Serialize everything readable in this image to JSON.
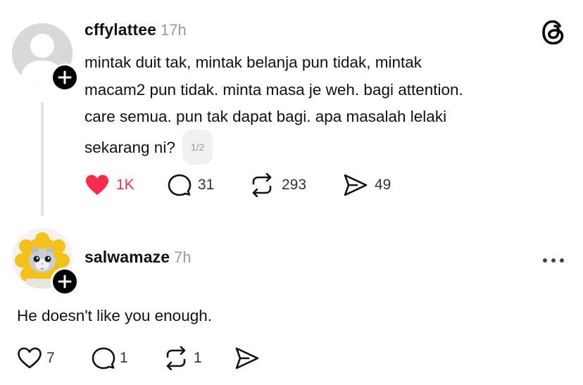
{
  "post": {
    "username": "cffylattee",
    "time": "17h",
    "text_lines": [
      "mintak duit tak, mintak belanja pun tidak, mintak",
      "macam2 pun tidak. minta masa je weh. bagi attention.",
      "care semua. pun tak dapat bagi. apa masalah lelaki",
      "sekarang ni?"
    ],
    "pager": "1/2",
    "likes": "1K",
    "comments": "31",
    "reposts": "293",
    "shares": "49"
  },
  "reply": {
    "username": "salwamaze",
    "time": "7h",
    "text": "He doesn't like you enough.",
    "likes": "7",
    "comments": "1",
    "reposts": "1"
  },
  "colors": {
    "like_active": "#ff2b4d",
    "muted": "#999999",
    "thread_line": "#e3e3e3"
  }
}
